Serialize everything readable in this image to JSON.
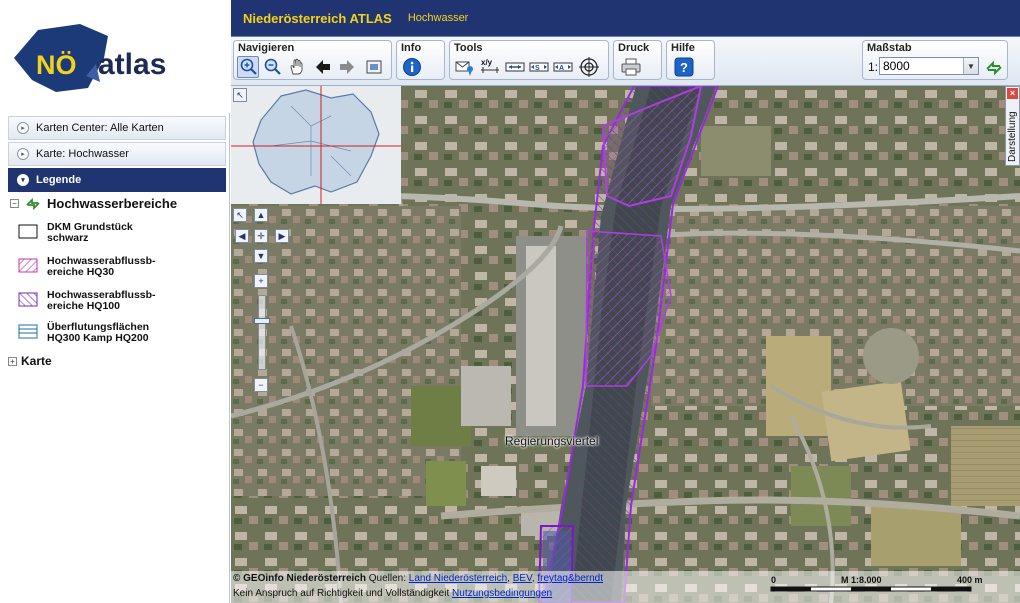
{
  "app": {
    "title": "Niederösterreich ATLAS",
    "subtitle": "Hochwasser",
    "logo_text": "atlas",
    "logo_prefix": "NÖ"
  },
  "toolbar": {
    "groups": {
      "navigieren": "Navigieren",
      "info": "Info",
      "tools": "Tools",
      "druck": "Druck",
      "hilfe": "Hilfe",
      "massstab": "Maßstab"
    },
    "tools_xy_label": "x/y",
    "scale_prefix": "1:",
    "scale_value": "8000"
  },
  "sidebar": {
    "accordion": [
      {
        "label": "Karten Center: Alle Karten"
      },
      {
        "label": "Karte: Hochwasser"
      },
      {
        "label": "Legende"
      }
    ],
    "tree": {
      "group_label": "Hochwasserbereiche",
      "items": [
        {
          "line1": "DKM Grundstück",
          "line2": "schwarz"
        },
        {
          "line1": "Hochwasserabflussb-",
          "line2": "ereiche HQ30"
        },
        {
          "line1": "Hochwasserabflussb-",
          "line2": "ereiche HQ100"
        },
        {
          "line1": "Überflutungsflächen",
          "line2": "HQ300 Kamp HQ200"
        }
      ],
      "karte_label": "Karte"
    }
  },
  "map": {
    "place_label": "Regierungsviertel",
    "side_tab_label": "Darstellung",
    "copyright_prefix": "© GEOinfo Niederösterreich",
    "sources_label": "Quellen:",
    "sources": [
      "Land Niederösterreich",
      "BEV",
      "freytag&berndt"
    ],
    "disclaimer": "Kein Anspruch auf Richtigkeit und Vollständigkeit",
    "terms_link": "Nutzungsbedingungen",
    "scalebar": {
      "start": "0",
      "middle": "M 1:8.000",
      "end": "400 m"
    }
  },
  "colors": {
    "title_bg": "#1f3470",
    "title_text": "#f5d21a",
    "hq_hatch": "#8a33d6",
    "flood_outline": "#a021e8"
  },
  "icons": {
    "zoom_in": "zoom-in-icon",
    "zoom_out": "zoom-out-icon",
    "pan": "hand-pan-icon",
    "back": "arrow-back-icon",
    "forward": "arrow-forward-icon",
    "full_extent": "full-extent-icon",
    "info": "info-icon",
    "print": "printer-icon",
    "help": "help-icon",
    "refresh": "refresh-icon"
  }
}
